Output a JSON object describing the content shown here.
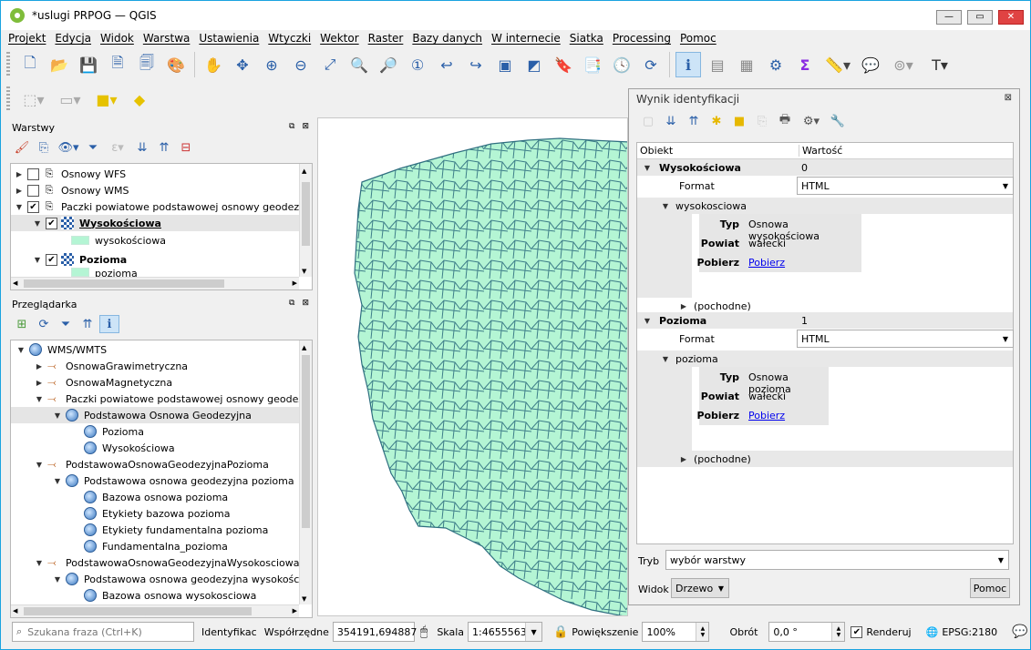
{
  "window": {
    "title": "*uslugi PRPOG — QGIS",
    "min": "—",
    "max": "▭",
    "close": "✕"
  },
  "menu": [
    "Projekt",
    "Edycja",
    "Widok",
    "Warstwa",
    "Ustawienia",
    "Wtyczki",
    "Wektor",
    "Raster",
    "Bazy danych",
    "W internecie",
    "Siatka",
    "Processing",
    "Pomoc"
  ],
  "layers_panel": {
    "title": "Warstwy",
    "rows": [
      {
        "label": "Osnowy WFS",
        "checked": false,
        "expanded": false,
        "bold": false
      },
      {
        "label": "Osnowy WMS",
        "checked": false,
        "expanded": false,
        "bold": false
      },
      {
        "label": "Paczki powiatowe podstawowej osnowy geodez",
        "checked": true,
        "expanded": true,
        "bold": false
      },
      {
        "label": "Wysokościowa",
        "checked": true,
        "expanded": true,
        "bold": true
      },
      {
        "label": "wysokościowa",
        "legend": true
      },
      {
        "label": "Pozioma",
        "checked": true,
        "expanded": true,
        "bold": true
      },
      {
        "label": "pozioma",
        "legend": true
      }
    ]
  },
  "browser_panel": {
    "title": "Przeglądarka",
    "rows": [
      {
        "label": "WMS/WMTS",
        "level": 0,
        "kind": "root",
        "open": true
      },
      {
        "label": "OsnowaGrawimetryczna",
        "level": 1,
        "kind": "wms",
        "open": false
      },
      {
        "label": "OsnowaMagnetyczna",
        "level": 1,
        "kind": "wms",
        "open": false
      },
      {
        "label": "Paczki powiatowe podstawowej osnowy geodez",
        "level": 1,
        "kind": "wms",
        "open": true
      },
      {
        "label": "Podstawowa Osnowa Geodezyjna",
        "level": 2,
        "kind": "globe",
        "open": true,
        "selected": true
      },
      {
        "label": "Pozioma",
        "level": 3,
        "kind": "globe"
      },
      {
        "label": "Wysokościowa",
        "level": 3,
        "kind": "globe"
      },
      {
        "label": "PodstawowaOsnowaGeodezyjnaPozioma",
        "level": 1,
        "kind": "wms",
        "open": true
      },
      {
        "label": "Podstawowa osnowa geodezyjna pozioma",
        "level": 2,
        "kind": "globe",
        "open": true
      },
      {
        "label": "Bazowa osnowa pozioma",
        "level": 3,
        "kind": "globe"
      },
      {
        "label": "Etykiety bazowa pozioma",
        "level": 3,
        "kind": "globe"
      },
      {
        "label": "Etykiety fundamentalna pozioma",
        "level": 3,
        "kind": "globe"
      },
      {
        "label": "Fundamentalna_pozioma",
        "level": 3,
        "kind": "globe"
      },
      {
        "label": "PodstawowaOsnowaGeodezyjnaWysokosciowa",
        "level": 1,
        "kind": "wms",
        "open": true
      },
      {
        "label": "Podstawowa osnowa geodezyjna wysokości",
        "level": 2,
        "kind": "globe",
        "open": true
      },
      {
        "label": "Bazowa osnowa wysokosciowa",
        "level": 3,
        "kind": "globe"
      }
    ]
  },
  "identify": {
    "title": "Wynik identyfikacji",
    "col_object": "Obiekt",
    "col_value": "Wartość",
    "results": [
      {
        "layer": "Wysokościowa",
        "index": "0",
        "format_label": "Format",
        "format_value": "HTML",
        "feature": "wysokosciowa",
        "typ_key": "Typ",
        "typ": "Osnowa wysokościowa",
        "powiat_key": "Powiat",
        "powiat": "wałecki",
        "pobierz_key": "Pobierz",
        "pobierz": "Pobierz",
        "derived": "(pochodne)"
      },
      {
        "layer": "Pozioma",
        "index": "1",
        "format_label": "Format",
        "format_value": "HTML",
        "feature": "pozioma",
        "typ_key": "Typ",
        "typ": "Osnowa pozioma",
        "powiat_key": "Powiat",
        "powiat": "wałecki",
        "pobierz_key": "Pobierz",
        "pobierz": "Pobierz",
        "derived": "(pochodne)"
      }
    ],
    "mode_label": "Tryb",
    "mode_value": "wybór warstwy",
    "view_label": "Widok",
    "view_value": "Drzewo",
    "help_button": "Pomoc"
  },
  "status": {
    "search_placeholder": "Szukana fraza (Ctrl+K)",
    "tool": "Identyfikac",
    "coord_label": "Współrzędne",
    "coord_value": "354191,694887",
    "scale_label": "Skala",
    "scale_value": "1:4655563",
    "zoom_label": "Powiększenie",
    "zoom_value": "100%",
    "rotation_label": "Obrót",
    "rotation_value": "0,0 °",
    "render_label": "Renderuj",
    "crs": "EPSG:2180"
  },
  "colors": {
    "map_fill": "#b4f5d4",
    "map_stroke": "#2f6f80",
    "accent": "#1aa3e0"
  }
}
